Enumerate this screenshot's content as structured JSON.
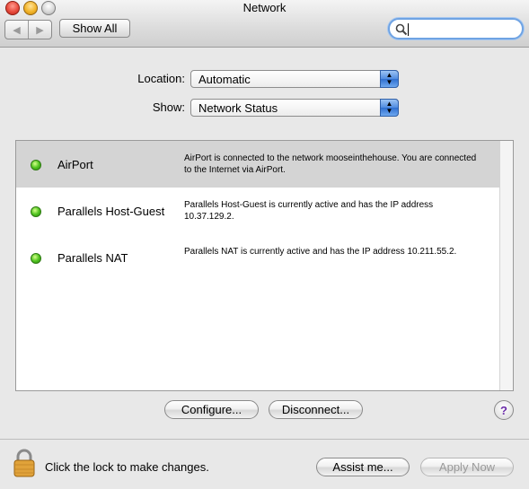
{
  "window": {
    "title": "Network"
  },
  "toolbar": {
    "back_glyph": "◀",
    "forward_glyph": "▶",
    "show_all_label": "Show All",
    "search": {
      "value": "",
      "placeholder": ""
    }
  },
  "location": {
    "label": "Location:",
    "value": "Automatic"
  },
  "show": {
    "label": "Show:",
    "value": "Network Status"
  },
  "status_list": {
    "rows": [
      {
        "name": "AirPort",
        "status_color": "#52c521",
        "description": "AirPort is connected to the network mooseinthehouse. You are connected to the Internet via AirPort."
      },
      {
        "name": "Parallels Host-Guest",
        "status_color": "#52c521",
        "description": "Parallels Host-Guest is currently active and has the IP address 10.37.129.2."
      },
      {
        "name": "Parallels NAT",
        "status_color": "#52c521",
        "description": "Parallels NAT is currently active and has the IP address 10.211.55.2."
      }
    ]
  },
  "buttons": {
    "configure": "Configure...",
    "disconnect": "Disconnect...",
    "help": "?",
    "assist": "Assist me...",
    "apply": "Apply Now"
  },
  "footer": {
    "lock_text": "Click the lock to make changes."
  },
  "colors": {
    "selection": "#d4d4d4",
    "accent": "#4f8be0",
    "status_green": "#52c521"
  }
}
